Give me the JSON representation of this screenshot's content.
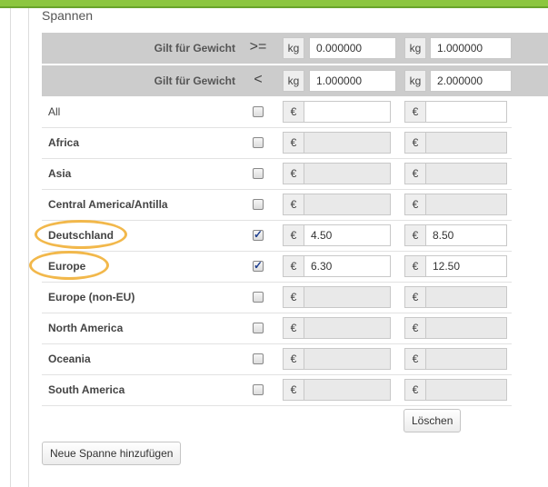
{
  "section": {
    "title": "Spannen"
  },
  "weight_headers": [
    {
      "label": "Gilt für Gewicht",
      "operator": ">=",
      "unit": "kg",
      "col1": "0.000000",
      "col2": "1.000000"
    },
    {
      "label": "Gilt für Gewicht",
      "operator": "<",
      "unit": "kg",
      "col1": "1.000000",
      "col2": "2.000000"
    }
  ],
  "currency_symbol": "€",
  "rows": [
    {
      "name": "All",
      "checked": false,
      "enabled": true,
      "col1": "",
      "col2": ""
    },
    {
      "name": "Africa",
      "checked": false,
      "enabled": false,
      "col1": "",
      "col2": ""
    },
    {
      "name": "Asia",
      "checked": false,
      "enabled": false,
      "col1": "",
      "col2": ""
    },
    {
      "name": "Central America/Antilla",
      "checked": false,
      "enabled": false,
      "col1": "",
      "col2": ""
    },
    {
      "name": "Deutschland",
      "checked": true,
      "enabled": true,
      "col1": "4.50",
      "col2": "8.50"
    },
    {
      "name": "Europe",
      "checked": true,
      "enabled": true,
      "col1": "6.30",
      "col2": "12.50"
    },
    {
      "name": "Europe (non-EU)",
      "checked": false,
      "enabled": false,
      "col1": "",
      "col2": ""
    },
    {
      "name": "North America",
      "checked": false,
      "enabled": false,
      "col1": "",
      "col2": ""
    },
    {
      "name": "Oceania",
      "checked": false,
      "enabled": false,
      "col1": "",
      "col2": ""
    },
    {
      "name": "South America",
      "checked": false,
      "enabled": false,
      "col1": "",
      "col2": ""
    }
  ],
  "buttons": {
    "delete_label": "Löschen",
    "add_label": "Neue Spanne hinzufügen"
  },
  "colors": {
    "accent_green": "#8cc63f",
    "highlight_circle": "#f2b84b",
    "header_bg": "#cccccc"
  }
}
